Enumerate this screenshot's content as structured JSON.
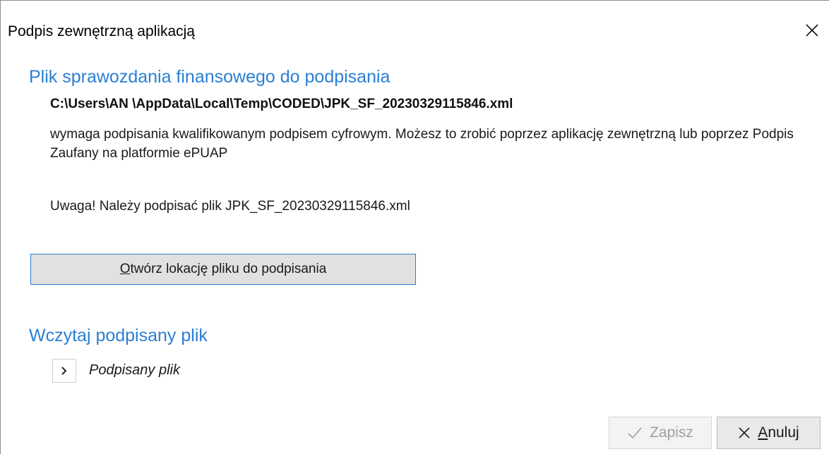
{
  "window": {
    "title": "Podpis zewnętrzną aplikacją"
  },
  "file_section": {
    "heading": "Plik sprawozdania finansowego do podpisania",
    "path": "C:\\Users\\AN \\AppData\\Local\\Temp\\CODED\\JPK_SF_20230329115846.xml",
    "description": "wymaga podpisania kwalifikowanym podpisem cyfrowym. Możesz to zrobić poprzez aplikację zewnętrzną lub poprzez Podpis Zaufany na platformie ePUAP",
    "warning": "Uwaga! Należy podpisać plik JPK_SF_20230329115846.xml",
    "open_button": {
      "accel": "O",
      "rest": "twórz lokację pliku do podpisania"
    }
  },
  "load_section": {
    "heading": "Wczytaj podpisany plik",
    "expander_label": "Podpisany plik"
  },
  "footer": {
    "save_label": "Zapisz",
    "cancel_accel": "A",
    "cancel_rest": "nuluj"
  },
  "colors": {
    "accent": "#2a7fd4",
    "disabled_text": "#a0a0a0"
  },
  "icons": {
    "close": "close-icon",
    "expand": "chevron-right-icon",
    "save": "checkmark-icon",
    "cancel": "x-icon"
  }
}
